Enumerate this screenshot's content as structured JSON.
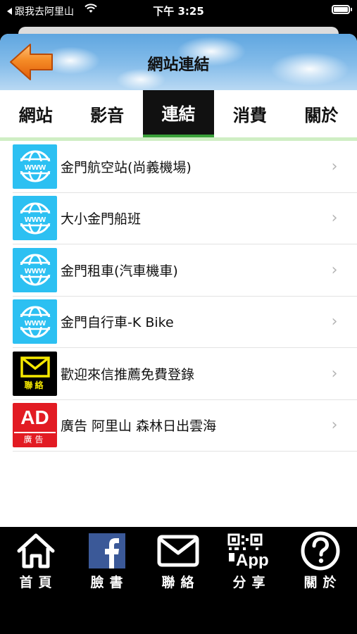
{
  "status_bar": {
    "back_app": "跟我去阿里山",
    "time": "下午 3:25"
  },
  "header": {
    "title": "網站連結"
  },
  "tabs": [
    {
      "label": "網站",
      "active": false
    },
    {
      "label": "影音",
      "active": false
    },
    {
      "label": "連結",
      "active": true
    },
    {
      "label": "消費",
      "active": false
    },
    {
      "label": "關於",
      "active": false
    }
  ],
  "links": [
    {
      "icon": "globe-www-icon",
      "label": "金門航空站(尚義機場)"
    },
    {
      "icon": "globe-www-icon",
      "label": "大小金門船班"
    },
    {
      "icon": "globe-www-icon",
      "label": "金門租車(汽車機車)"
    },
    {
      "icon": "globe-www-icon",
      "label": "金門自行車-K Bike"
    },
    {
      "icon": "mail-contact-icon",
      "label": "歡迎來信推薦免費登錄",
      "icon_text": "聯絡"
    },
    {
      "icon": "ad-icon",
      "label": "廣告 阿里山 森林日出雲海",
      "icon_text": "AD",
      "icon_subtext": "廣告"
    }
  ],
  "bottom_nav": [
    {
      "icon": "home-icon",
      "label": "首頁"
    },
    {
      "icon": "facebook-icon",
      "label": "臉書"
    },
    {
      "icon": "mail-icon",
      "label": "聯絡"
    },
    {
      "icon": "qr-app-icon",
      "label": "分享",
      "icon_text": "App"
    },
    {
      "icon": "help-icon",
      "label": "關於"
    }
  ],
  "colors": {
    "accent_green": "#3aa13a",
    "tab_underline": "#cfeec4",
    "www_blue": "#2cc0f2",
    "ad_red": "#e21b23",
    "mail_yellow": "#f5e800",
    "back_arrow_orange": "#f07a12"
  }
}
